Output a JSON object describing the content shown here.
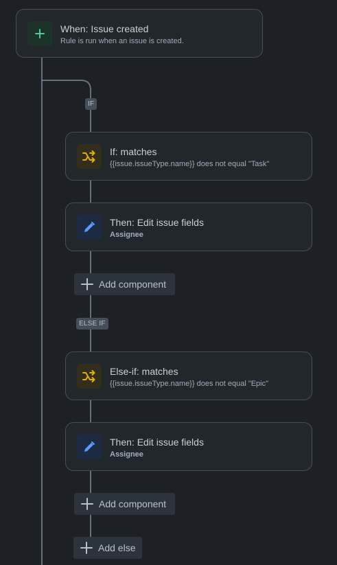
{
  "trigger": {
    "title": "When: Issue created",
    "subtitle": "Rule is run when an issue is created.",
    "icon": "plus-icon"
  },
  "branches": [
    {
      "label": "IF",
      "condition": {
        "title": "If: matches",
        "subtitle": "{{issue.issueType.name}} does not equal \"Task\"",
        "icon": "branch-icon"
      },
      "action": {
        "title": "Then: Edit issue fields",
        "subtitle": "Assignee",
        "icon": "pencil-icon"
      },
      "add_component_label": "Add component"
    },
    {
      "label": "ELSE IF",
      "condition": {
        "title": "Else-if: matches",
        "subtitle": "{{issue.issueType.name}} does not equal \"Epic\"",
        "icon": "branch-icon"
      },
      "action": {
        "title": "Then: Edit issue fields",
        "subtitle": "Assignee",
        "icon": "pencil-icon"
      },
      "add_component_label": "Add component"
    }
  ],
  "add_else_label": "Add else",
  "colors": {
    "background": "#1d2125",
    "card": "#22272b",
    "card_border": "#454f59",
    "trigger_icon": "#4bce97",
    "condition_icon": "#e2b203",
    "action_icon": "#579dff"
  }
}
